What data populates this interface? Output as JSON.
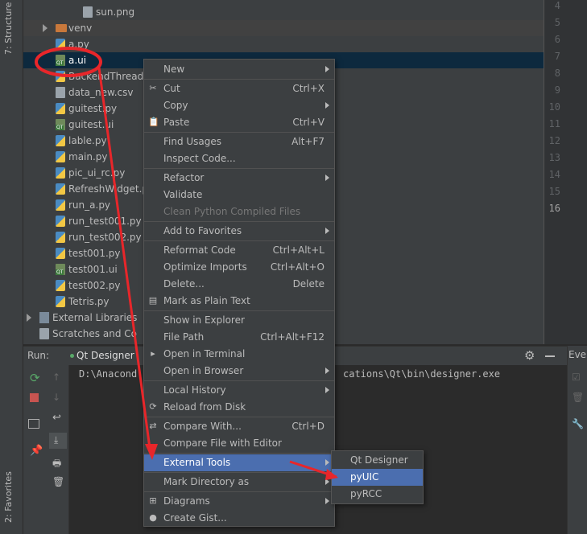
{
  "left_strip": {
    "structure_label": "7: Structure",
    "favorites_label": "2: Favorites"
  },
  "tree": [
    {
      "name": "sun.png",
      "icon": "image-file-icon",
      "indent": 74,
      "selected": false
    },
    {
      "name": "venv",
      "icon": "folder-icon",
      "indent": 40,
      "selected": false,
      "folder": true
    },
    {
      "name": "a.py",
      "icon": "python-file-icon",
      "indent": 40,
      "selected": false
    },
    {
      "name": "a.ui",
      "icon": "qt-ui-file-icon",
      "indent": 40,
      "selected": true
    },
    {
      "name": "BackendThread.",
      "icon": "python-file-icon",
      "indent": 40,
      "selected": false
    },
    {
      "name": "data_new.csv",
      "icon": "csv-file-icon",
      "indent": 40,
      "selected": false
    },
    {
      "name": "guitest.py",
      "icon": "python-file-icon",
      "indent": 40,
      "selected": false
    },
    {
      "name": "guitest.ui",
      "icon": "qt-ui-file-icon",
      "indent": 40,
      "selected": false
    },
    {
      "name": "lable.py",
      "icon": "python-file-icon",
      "indent": 40,
      "selected": false
    },
    {
      "name": "main.py",
      "icon": "python-file-icon",
      "indent": 40,
      "selected": false
    },
    {
      "name": "pic_ui_rc.py",
      "icon": "python-file-icon",
      "indent": 40,
      "selected": false
    },
    {
      "name": "RefreshWidget.p",
      "icon": "python-file-icon",
      "indent": 40,
      "selected": false
    },
    {
      "name": "run_a.py",
      "icon": "python-file-icon",
      "indent": 40,
      "selected": false
    },
    {
      "name": "run_test001.py",
      "icon": "python-file-icon",
      "indent": 40,
      "selected": false
    },
    {
      "name": "run_test002.py",
      "icon": "python-file-icon",
      "indent": 40,
      "selected": false
    },
    {
      "name": "test001.py",
      "icon": "python-file-icon",
      "indent": 40,
      "selected": false
    },
    {
      "name": "test001.ui",
      "icon": "qt-ui-file-icon",
      "indent": 40,
      "selected": false
    },
    {
      "name": "test002.py",
      "icon": "python-file-icon",
      "indent": 40,
      "selected": false
    },
    {
      "name": "Tetris.py",
      "icon": "python-file-icon",
      "indent": 40,
      "selected": false
    },
    {
      "name": "External Libraries",
      "icon": "library-icon",
      "indent": 20,
      "selected": false,
      "folder": true
    },
    {
      "name": "Scratches and Co",
      "icon": "scratches-icon",
      "indent": 20,
      "selected": false
    }
  ],
  "gutter_lines": [
    "4",
    "5",
    "6",
    "7",
    "8",
    "9",
    "10",
    "11",
    "12",
    "13",
    "14",
    "15",
    "16"
  ],
  "run": {
    "label": "Run:",
    "tab": "Qt Designer",
    "output_left": "D:\\Anacond",
    "output_right": "cations\\Qt\\bin\\designer.exe",
    "event_label": "Ever"
  },
  "context_menu": [
    {
      "label": "New",
      "shortcut": "",
      "sub": true
    },
    {
      "sep": true
    },
    {
      "label": "Cut",
      "shortcut": "Ctrl+X",
      "icon": "cut-icon",
      "glyph": "✂"
    },
    {
      "label": "Copy",
      "shortcut": "",
      "sub": true
    },
    {
      "label": "Paste",
      "shortcut": "Ctrl+V",
      "icon": "paste-icon",
      "glyph": "📋"
    },
    {
      "sep": true
    },
    {
      "label": "Find Usages",
      "shortcut": "Alt+F7"
    },
    {
      "label": "Inspect Code...",
      "shortcut": ""
    },
    {
      "sep": true
    },
    {
      "label": "Refactor",
      "shortcut": "",
      "sub": true
    },
    {
      "label": "Validate",
      "shortcut": ""
    },
    {
      "label": "Clean Python Compiled Files",
      "shortcut": "",
      "disabled": true
    },
    {
      "sep": true
    },
    {
      "label": "Add to Favorites",
      "shortcut": "",
      "sub": true
    },
    {
      "sep": true
    },
    {
      "label": "Reformat Code",
      "shortcut": "Ctrl+Alt+L"
    },
    {
      "label": "Optimize Imports",
      "shortcut": "Ctrl+Alt+O"
    },
    {
      "label": "Delete...",
      "shortcut": "Delete"
    },
    {
      "label": "Mark as Plain Text",
      "shortcut": "",
      "icon": "plain-text-icon",
      "glyph": "▤"
    },
    {
      "sep": true
    },
    {
      "label": "Show in Explorer",
      "shortcut": ""
    },
    {
      "label": "File Path",
      "shortcut": "Ctrl+Alt+F12"
    },
    {
      "label": "Open in Terminal",
      "shortcut": "",
      "icon": "terminal-icon",
      "glyph": "▸"
    },
    {
      "label": "Open in Browser",
      "shortcut": "",
      "sub": true
    },
    {
      "sep": true
    },
    {
      "label": "Local History",
      "shortcut": "",
      "sub": true
    },
    {
      "label": "Reload from Disk",
      "shortcut": "",
      "icon": "reload-icon",
      "glyph": "⟳"
    },
    {
      "sep": true
    },
    {
      "label": "Compare With...",
      "shortcut": "Ctrl+D",
      "icon": "compare-icon",
      "glyph": "⇄"
    },
    {
      "label": "Compare File with Editor",
      "shortcut": ""
    },
    {
      "sep": true
    },
    {
      "label": "External Tools",
      "shortcut": "",
      "sub": true,
      "highlight": true
    },
    {
      "sep": true
    },
    {
      "label": "Mark Directory as",
      "shortcut": "",
      "sub": true
    },
    {
      "sep": true
    },
    {
      "label": "Diagrams",
      "shortcut": "",
      "sub": true,
      "icon": "diagram-icon",
      "glyph": "⊞"
    },
    {
      "label": "Create Gist...",
      "shortcut": "",
      "icon": "github-icon",
      "glyph": "●"
    }
  ],
  "submenu": [
    {
      "label": "Qt Designer",
      "highlight": false
    },
    {
      "label": "pyUIC",
      "highlight": true
    },
    {
      "label": "pyRCC",
      "highlight": false
    }
  ],
  "annotation_color": "#e8262a"
}
